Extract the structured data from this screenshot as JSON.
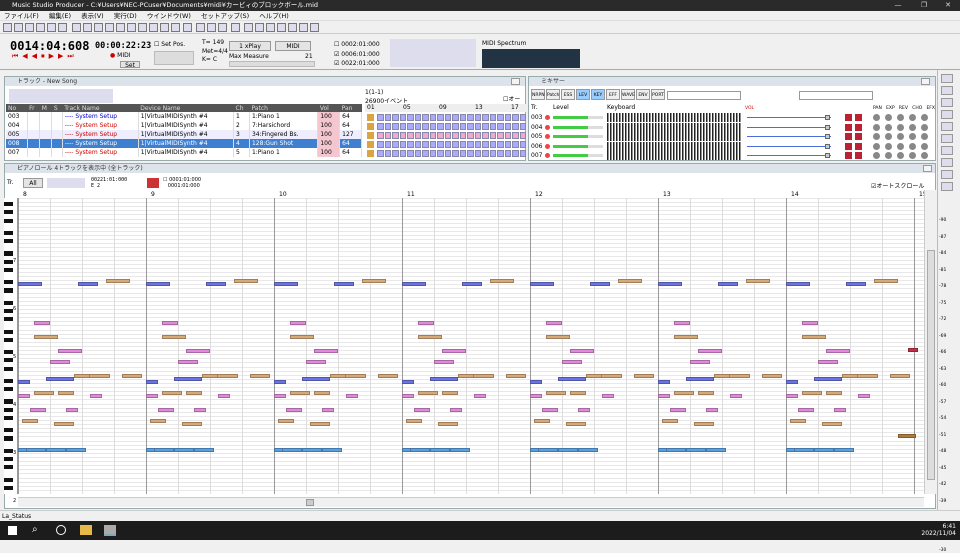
{
  "window": {
    "title": "Music Studio Producer - C:¥Users¥NEC-PCuser¥Documents¥midi¥カービィのブロックボール.mid"
  },
  "menu": [
    "ファイル(F)",
    "編集(E)",
    "表示(V)",
    "実行(D)",
    "ウインドウ(W)",
    "セットアップ(S)",
    "ヘルプ(H)"
  ],
  "transport": {
    "position": "0014:04:608",
    "time": "00:00:22:23",
    "set_pos_label": "Set Pos.",
    "tempo_label": "T=",
    "tempo": "149",
    "meter_label": "Met=",
    "meter": "4/4",
    "key_label": "K=",
    "key": "C",
    "play_mode": "1 xPlay",
    "midi_label": "MIDI",
    "max_measure_label": "Max Measure",
    "max_measure": "21",
    "loc1": "0002:01:000",
    "loc2": "0006:01:000",
    "loc3": "0022:01:000",
    "midi_in_label": "MIDI",
    "set_label": "Set",
    "spectrum_label": "MIDI Spectrum"
  },
  "track_window": {
    "title": "トラック - New Song",
    "range_label": "1(1-1)",
    "event_count": "26900イベント",
    "auto_label": "オート",
    "columns": [
      "No",
      "Fr",
      "M",
      "S",
      "Track Name",
      "Device Name",
      "Ch",
      "Patch",
      "Vol",
      "Pan"
    ],
    "measure_ruler": [
      "01",
      "05",
      "09",
      "13",
      "17"
    ],
    "rows": [
      {
        "no": "003",
        "name": "---- System Setup",
        "device": "1|VirtualMIDISynth #4",
        "ch": "1",
        "patch": "1:Piano 1",
        "vol": "100",
        "pan": "64"
      },
      {
        "no": "004",
        "name": "---- System Setup",
        "device": "1|VirtualMIDISynth #4",
        "ch": "2",
        "patch": "7:Harsichord",
        "vol": "100",
        "pan": "64"
      },
      {
        "no": "005",
        "name": "---- System Setup",
        "device": "1|VirtualMIDISynth #4",
        "ch": "3",
        "patch": "34:Fingered Bs.",
        "vol": "100",
        "pan": "127"
      },
      {
        "no": "008",
        "name": "---- System Setup",
        "device": "1|VirtualMIDISynth #4",
        "ch": "4",
        "patch": "128:Gun Shot",
        "vol": "100",
        "pan": "64"
      },
      {
        "no": "007",
        "name": "---- System Setup",
        "device": "1|VirtualMIDISynth #4",
        "ch": "5",
        "patch": "1:Piano 1",
        "vol": "100",
        "pan": "64"
      }
    ]
  },
  "mixer_window": {
    "title": "ミキサー",
    "tabs": [
      "NRPN",
      "Patch",
      "ESS",
      "LEV",
      "KEY",
      "EFF",
      "WAVE",
      "ENV",
      "PORT"
    ],
    "col_tr": "Tr.",
    "col_level": "Level",
    "col_keyboard": "Keyboard",
    "col_vol": "VOL",
    "knob_labels": [
      "PAN",
      "EXP",
      "REV",
      "CHO",
      "EFX"
    ],
    "rows": [
      "003",
      "004",
      "005",
      "006",
      "007"
    ]
  },
  "pianoroll": {
    "title": "ピアノロール 4トラックを表示中 (全トラック)",
    "track_label": "Tr.",
    "track_select": "All",
    "pos1": "00221:01:000",
    "pos2": "E 2",
    "loc_a": "0001:01:000",
    "loc_b": "0001:01:000",
    "autoscroll": "オートスクロール",
    "measures": [
      "8",
      "9",
      "10",
      "11",
      "12",
      "13",
      "14",
      "15"
    ],
    "octaves": [
      "7",
      "6",
      "5",
      "4",
      "3",
      "2"
    ],
    "right_values": [
      "-90",
      "-87",
      "-84",
      "-81",
      "-78",
      "-75",
      "-72",
      "-69",
      "-66",
      "-63",
      "-60",
      "-57",
      "-54",
      "-51",
      "-48",
      "-45",
      "-42",
      "-39",
      "-36",
      "-33",
      "-30"
    ]
  },
  "status": {
    "text": "La_Status"
  },
  "taskbar": {
    "time": "6:41",
    "date": "2022/11/04"
  },
  "colors": {
    "blue": "#6b74e0",
    "tan": "#d6aa78",
    "pink": "#e08ad8",
    "light_blue": "#5aa0e0",
    "brown": "#b27a3a",
    "darkred": "#c0304a"
  }
}
